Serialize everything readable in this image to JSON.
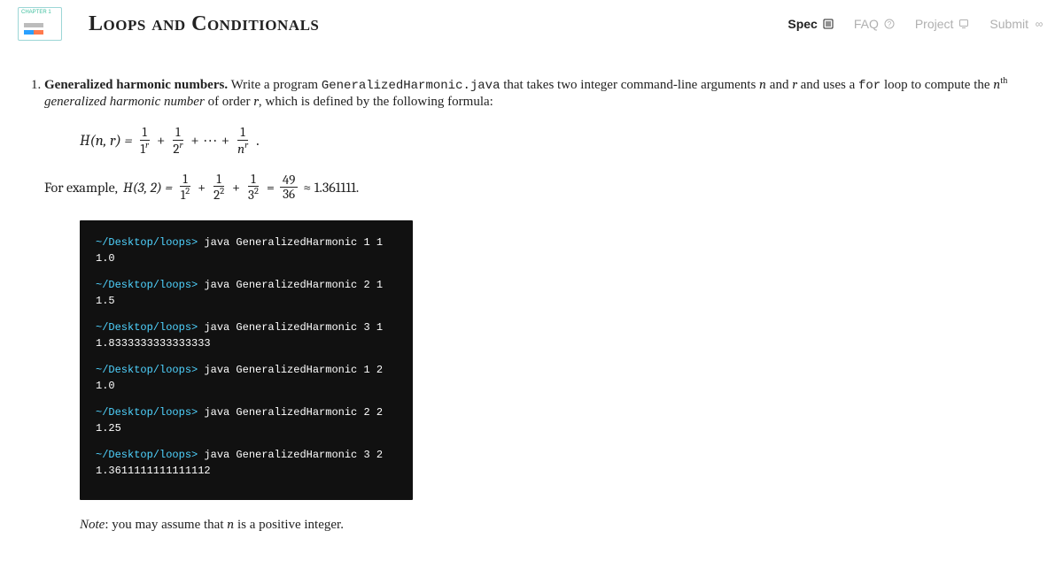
{
  "header": {
    "title": "Loops and Conditionals",
    "nav": {
      "spec": "Spec",
      "faq": "FAQ",
      "project": "Project",
      "submit": "Submit"
    }
  },
  "problem": {
    "title": "Generalized harmonic numbers.",
    "desc_before_code": "Write a program ",
    "program_name": "GeneralizedHarmonic.java",
    "desc_after_code": " that takes two integer command-line arguments ",
    "arg_n": "n",
    "and": " and ",
    "arg_r": "r",
    "uses_for": " and uses a ",
    "for_kw": "for",
    "desc_tail_1": " loop to compute the ",
    "nth": "n",
    "nth_sup": "th",
    "term_name": " generalized harmonic number",
    "term_tail": " of order ",
    "r_var": "r",
    "formula_tail": ", which is defined by the following formula:",
    "formula": {
      "lhs": "H(n, r) =",
      "t1_num": "1",
      "t1_den_base": "1",
      "t1_den_sup": "r",
      "plus": "+",
      "t2_num": "1",
      "t2_den_base": "2",
      "t2_den_sup": "r",
      "dots": "· · ·",
      "tn_num": "1",
      "tn_den_base": "n",
      "tn_den_sup": "r",
      "period": "."
    },
    "example": {
      "prefix": "For example, ",
      "lhs": "H(3, 2) =",
      "a_num": "1",
      "a_den_base": "1",
      "a_den_sup": "2",
      "plus": "+",
      "b_num": "1",
      "b_den_base": "2",
      "b_den_sup": "2",
      "c_num": "1",
      "c_den_base": "3",
      "c_den_sup": "2",
      "eq": "=",
      "frac_num": "49",
      "frac_den": "36",
      "approx": "≈ 1.361111."
    },
    "terminal": {
      "prompt": "~/Desktop/loops>",
      "runs": [
        {
          "cmd": "java GeneralizedHarmonic 1 1",
          "out": "1.0"
        },
        {
          "cmd": "java GeneralizedHarmonic 2 1",
          "out": "1.5"
        },
        {
          "cmd": "java GeneralizedHarmonic 3 1",
          "out": "1.8333333333333333"
        },
        {
          "cmd": "java GeneralizedHarmonic 1 2",
          "out": "1.0"
        },
        {
          "cmd": "java GeneralizedHarmonic 2 2",
          "out": "1.25"
        },
        {
          "cmd": "java GeneralizedHarmonic 3 2",
          "out": "1.3611111111111112"
        }
      ]
    },
    "note_label": "Note",
    "note_text_1": ": you may assume that ",
    "note_var": "n",
    "note_text_2": " is a positive integer."
  }
}
